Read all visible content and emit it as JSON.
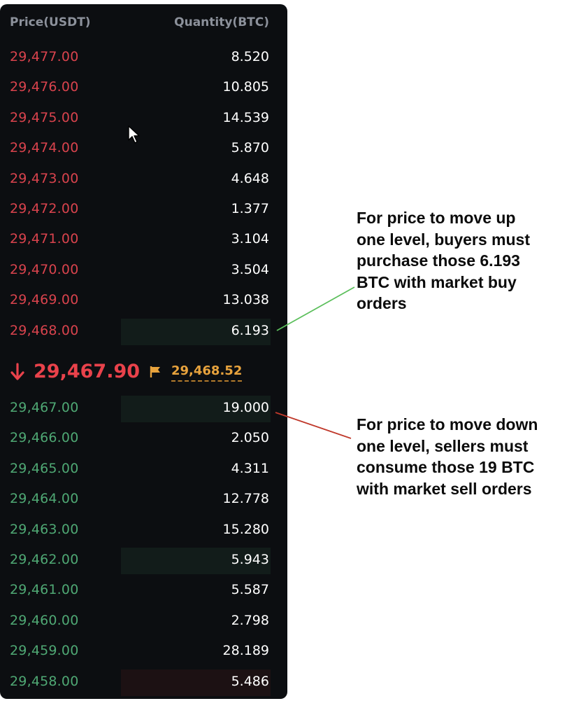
{
  "orderbook": {
    "headers": {
      "price": "Price(USDT)",
      "quantity": "Quantity(BTC)"
    },
    "asks": [
      {
        "price": "29,477.00",
        "qty": "8.520"
      },
      {
        "price": "29,476.00",
        "qty": "10.805"
      },
      {
        "price": "29,475.00",
        "qty": "14.539"
      },
      {
        "price": "29,474.00",
        "qty": "5.870"
      },
      {
        "price": "29,473.00",
        "qty": "4.648"
      },
      {
        "price": "29,472.00",
        "qty": "1.377"
      },
      {
        "price": "29,471.00",
        "qty": "3.104"
      },
      {
        "price": "29,470.00",
        "qty": "3.504"
      },
      {
        "price": "29,469.00",
        "qty": "13.038"
      },
      {
        "price": "29,468.00",
        "qty": "6.193",
        "highlight": "#121c1a"
      }
    ],
    "mid": {
      "last_price": "29,467.90",
      "mark_price": "29,468.52",
      "direction": "down"
    },
    "bids": [
      {
        "price": "29,467.00",
        "qty": "19.000",
        "highlight": "#121c1a"
      },
      {
        "price": "29,466.00",
        "qty": "2.050"
      },
      {
        "price": "29,465.00",
        "qty": "4.311"
      },
      {
        "price": "29,464.00",
        "qty": "12.778"
      },
      {
        "price": "29,463.00",
        "qty": "15.280"
      },
      {
        "price": "29,462.00",
        "qty": "5.943",
        "highlight": "#121c1a"
      },
      {
        "price": "29,461.00",
        "qty": "5.587"
      },
      {
        "price": "29,460.00",
        "qty": "2.798"
      },
      {
        "price": "29,459.00",
        "qty": "28.189"
      },
      {
        "price": "29,458.00",
        "qty": "5.486",
        "highlight": "#1c1113"
      }
    ]
  },
  "annotations": {
    "buy_note": "For price to move up\none level, buyers must\npurchase those 6.193\nBTC with market buy\norders",
    "sell_note": "For price to move down\none level, sellers must\nconsume those 19 BTC\nwith market sell orders"
  },
  "colors": {
    "ask": "#d9434d",
    "bid": "#4fa874",
    "panel_bg": "#0c0e11",
    "mark": "#e8a33d",
    "buy_line": "#5cbf5c",
    "sell_line": "#c0392b"
  },
  "icons": {
    "mid_arrow": "arrow-down-icon",
    "flag": "flag-icon",
    "cursor": "mouse-cursor-icon"
  }
}
